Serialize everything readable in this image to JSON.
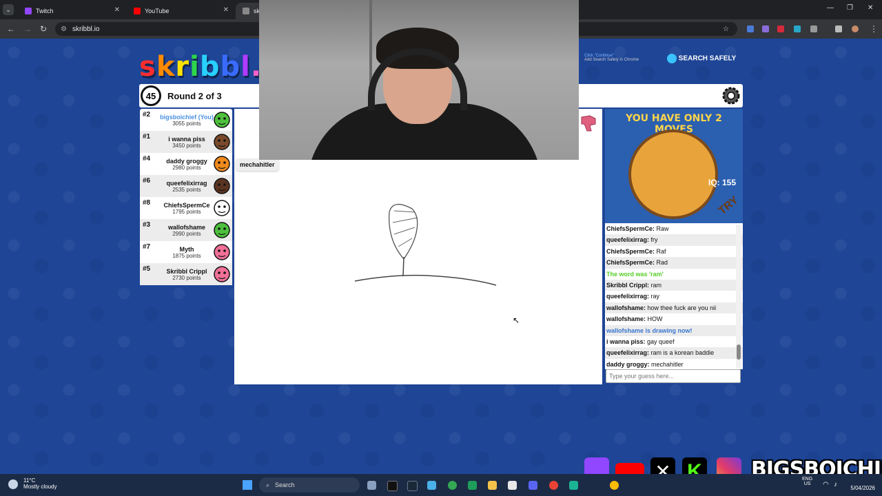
{
  "browser": {
    "tabs": [
      {
        "label": "Twitch",
        "color": "#9146ff"
      },
      {
        "label": "YouTube",
        "color": "#ff0000"
      },
      {
        "label": "skr",
        "color": "#888888"
      }
    ],
    "url": "skribbl.io"
  },
  "game": {
    "logo": "skribbl.io",
    "timer": "45",
    "round": "Round 2 of 3",
    "players": [
      {
        "rank": "#2",
        "name": "bigsboichief (You)",
        "points": "3055 points",
        "you": true,
        "color": "#4ec03d"
      },
      {
        "rank": "#1",
        "name": "i wanna piss",
        "points": "3450 points",
        "color": "#7b4a2c"
      },
      {
        "rank": "#4",
        "name": "daddy groggy",
        "points": "2980 points",
        "color": "#f08a1c"
      },
      {
        "rank": "#6",
        "name": "queefelixirrag",
        "points": "2535 points",
        "color": "#5a3421"
      },
      {
        "rank": "#8",
        "name": "ChiefsSpermCe",
        "points": "1795 points",
        "color": "#ffffff"
      },
      {
        "rank": "#3",
        "name": "wallofshame",
        "points": "2990 points",
        "color": "#4ec03d"
      },
      {
        "rank": "#7",
        "name": "Myth",
        "points": "1875 points",
        "color": "#f07098"
      },
      {
        "rank": "#5",
        "name": "Skribbl Crippl",
        "points": "2730 points",
        "color": "#f07098"
      }
    ],
    "bubble": "mechahitler"
  },
  "ad": {
    "title": "YOU HAVE ONLY 2 MOVES",
    "iq": "IQ: 155",
    "try": "TRY"
  },
  "search_safe": {
    "line1": "Click \"Continue\"",
    "line2": "Add Search Safely in Chrome",
    "logo": "SEARCH SAFELY"
  },
  "chat": {
    "messages": [
      {
        "user": "ChiefsSpermCe:",
        "text": "Raw"
      },
      {
        "user": "queefelixirrag:",
        "text": "fry"
      },
      {
        "user": "ChiefsSpermCe:",
        "text": "Raf"
      },
      {
        "user": "ChiefsSpermCe:",
        "text": "Rad"
      },
      {
        "system": "The word was 'ram'",
        "kind": "green"
      },
      {
        "user": "Skribbl Crippl:",
        "text": "ram"
      },
      {
        "user": "queefelixirrag:",
        "text": "ray"
      },
      {
        "user": "wallofshame:",
        "text": "how thee fuck are you nii"
      },
      {
        "user": "wallofshame:",
        "text": "HOW"
      },
      {
        "system": "wallofshame is drawing now!",
        "kind": "blue"
      },
      {
        "user": "i wanna piss:",
        "text": "gay queef"
      },
      {
        "user": "queefelixirrag:",
        "text": "ram is a korean baddie"
      },
      {
        "user": "daddy groggy:",
        "text": "mechahitler"
      }
    ],
    "placeholder": "Type your guess here..."
  },
  "taskbar": {
    "temp": "11°C",
    "weather": "Mostly cloudy",
    "search": "Search",
    "lang1": "ENG",
    "lang2": "US",
    "date": "5/04/2026"
  },
  "overlay": {
    "brand": "BIGSBOICHIEF"
  }
}
